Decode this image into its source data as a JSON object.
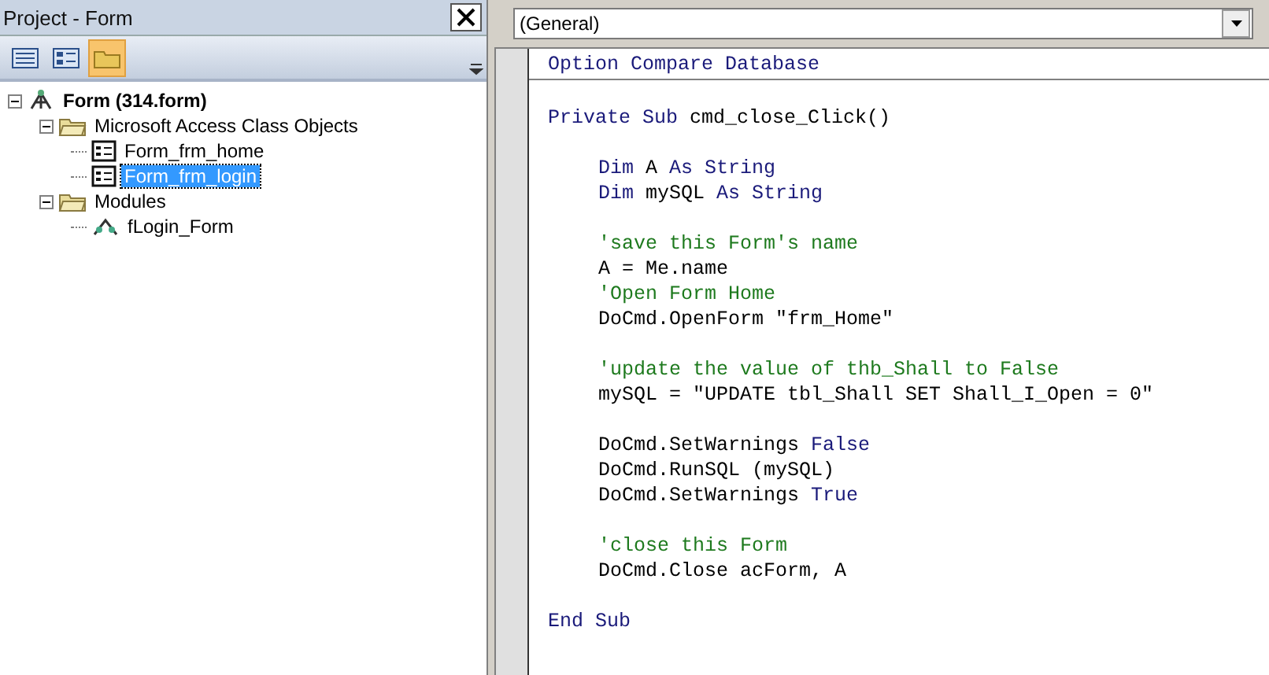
{
  "panel": {
    "title": "Project - Form",
    "toolbar": [
      {
        "kind": "view-object",
        "selected": false
      },
      {
        "kind": "view-code",
        "selected": false
      },
      {
        "kind": "folders",
        "selected": true
      }
    ],
    "tree": [
      {
        "label": "Form (314.form)",
        "kind": "project",
        "expanded": true,
        "selected": false,
        "children": [
          {
            "label": "Microsoft Access Class Objects",
            "kind": "folder",
            "expanded": true,
            "selected": false,
            "children": [
              {
                "label": "Form_frm_home",
                "kind": "form",
                "selected": false
              },
              {
                "label": "Form_frm_login",
                "kind": "form",
                "selected": true
              }
            ]
          },
          {
            "label": "Modules",
            "kind": "folder",
            "expanded": true,
            "selected": false,
            "children": [
              {
                "label": "fLogin_Form",
                "kind": "module",
                "selected": false
              }
            ]
          }
        ]
      }
    ]
  },
  "editor": {
    "object_box": "(General)",
    "declarations": [
      [
        {
          "kind": "kw",
          "text": "Option Compare Database"
        }
      ]
    ],
    "procedure": {
      "header": [
        {
          "kind": "kw",
          "text": "Private Sub"
        },
        {
          "kind": "text",
          "text": " cmd_close_Click()"
        }
      ],
      "body": [
        [
          [
            {
              "kind": "kw",
              "text": "Dim"
            },
            {
              "kind": "text",
              "text": " A "
            },
            {
              "kind": "kw",
              "text": "As String"
            }
          ],
          [
            {
              "kind": "kw",
              "text": "Dim"
            },
            {
              "kind": "text",
              "text": " mySQL "
            },
            {
              "kind": "kw",
              "text": "As String"
            }
          ]
        ],
        [
          [
            {
              "kind": "comment",
              "text": "'save this Form's name"
            }
          ],
          [
            {
              "kind": "text",
              "text": "A = Me.name"
            }
          ],
          [
            {
              "kind": "comment",
              "text": "'Open Form Home"
            }
          ],
          [
            {
              "kind": "text",
              "text": "DoCmd.OpenForm \"frm_Home\""
            }
          ]
        ],
        [
          [
            {
              "kind": "comment",
              "text": "'update the value of thb_Shall to False"
            }
          ],
          [
            {
              "kind": "text",
              "text": "mySQL = \"UPDATE tbl_Shall SET Shall_I_Open = 0\""
            }
          ]
        ],
        [
          [
            {
              "kind": "text",
              "text": "DoCmd.SetWarnings "
            },
            {
              "kind": "kw",
              "text": "False"
            }
          ],
          [
            {
              "kind": "text",
              "text": "DoCmd.RunSQL (mySQL)"
            }
          ],
          [
            {
              "kind": "text",
              "text": "DoCmd.SetWarnings "
            },
            {
              "kind": "kw",
              "text": "True"
            }
          ]
        ],
        [
          [
            {
              "kind": "comment",
              "text": "'close this Form"
            }
          ],
          [
            {
              "kind": "text",
              "text": "DoCmd.Close acForm, A"
            }
          ]
        ]
      ],
      "footer": [
        {
          "kind": "kw",
          "text": "End Sub"
        }
      ]
    }
  }
}
